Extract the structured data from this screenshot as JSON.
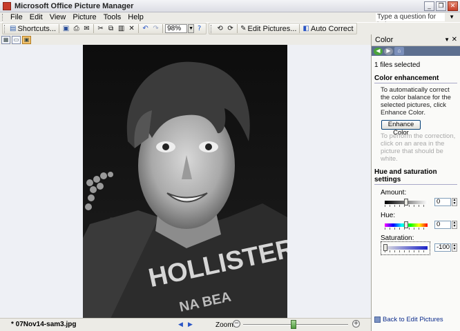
{
  "window": {
    "title": "Microsoft Office Picture Manager"
  },
  "menu": {
    "items": [
      "File",
      "Edit",
      "View",
      "Picture",
      "Tools",
      "Help"
    ],
    "help_placeholder": "Type a question for help"
  },
  "toolbar": {
    "shortcuts_label": "Shortcuts...",
    "zoom_value": "98%",
    "edit_pictures_label": "Edit Pictures...",
    "auto_correct_label": "Auto Correct"
  },
  "status": {
    "file_name": "* 07Nov14-sam3.jpg",
    "zoom_label": "Zoom:",
    "zoom_level": 0.48
  },
  "pane": {
    "title": "Color",
    "files_selected": "1 files selected",
    "color_enhancement_heading": "Color enhancement",
    "enhance_text": "To automatically correct the color balance for the selected pictures, click Enhance Color.",
    "enhance_button": "Enhance Color",
    "perform_text": "To perform the correction, click on an area in the picture that should be white.",
    "hue_sat_heading": "Hue and saturation settings",
    "amount_label": "Amount:",
    "amount_value": "0",
    "hue_label": "Hue:",
    "hue_value": "0",
    "saturation_label": "Saturation:",
    "saturation_value": "-100",
    "back_link": "Back to Edit Pictures"
  },
  "colors": {
    "pane_nav": "#5d6f8f",
    "accent": "#f3c36e"
  }
}
